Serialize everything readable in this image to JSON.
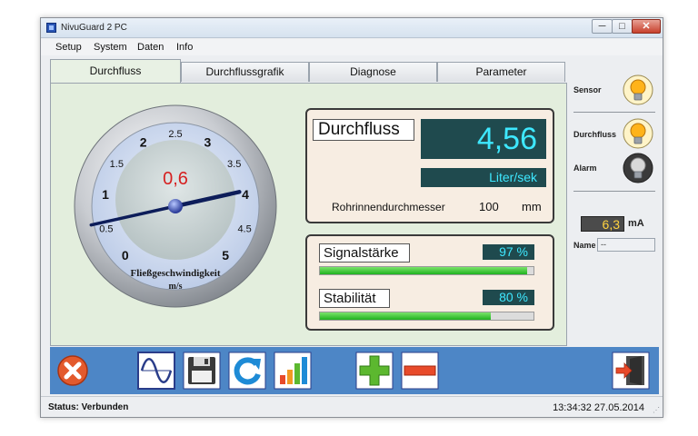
{
  "window": {
    "title": "NivuGuard 2  PC",
    "minimize": "─",
    "maximize": "□",
    "close": "✕"
  },
  "menu": [
    "Setup",
    "System",
    "Daten",
    "Info"
  ],
  "tabs": [
    {
      "label": "Durchfluss",
      "active": true
    },
    {
      "label": "Durchflussgrafik",
      "active": false
    },
    {
      "label": "Diagnose",
      "active": false
    },
    {
      "label": "Parameter",
      "active": false
    }
  ],
  "gauge": {
    "ticks": [
      "0",
      "0.5",
      "1",
      "1.5",
      "2",
      "2.5",
      "3",
      "3.5",
      "4",
      "4.5",
      "5"
    ],
    "value_display": "0,6",
    "needle_value": 0.6,
    "scale_min": 0,
    "scale_max": 5,
    "label": "Fließgeschwindigkeit",
    "unit": "m/s"
  },
  "flow": {
    "title": "Durchfluss",
    "value": "4,56",
    "unit": "Liter/sek",
    "diameter_label": "Rohrinnendurchmesser",
    "diameter_value": "100",
    "diameter_unit": "mm"
  },
  "signal": {
    "strength_label": "Signalstärke",
    "strength_value": "97 %",
    "strength_level": 97,
    "stability_label": "Stabilität",
    "stability_value": "80 %",
    "stability_level": 80
  },
  "side": {
    "sensor_label": "Sensor",
    "durchfluss_label": "Durchfluss",
    "alarm_label": "Alarm",
    "current_value": "6,3",
    "current_unit": "mA",
    "name_label": "Name",
    "name_value": "--"
  },
  "status": {
    "text": "Status: Verbunden",
    "time": "13:34:32 27.05.2014",
    "grip": "⋰"
  },
  "colors": {
    "toolbar": "#4d86c6",
    "display_bg": "#1f4a4e",
    "display_text": "#3ee8ff",
    "bar": "#1fb21f",
    "lamp_on": "#ffb31a",
    "lamp_off": "#d8d8d8"
  },
  "toolbar_icons": [
    "close-icon",
    "sine-wave-icon",
    "save-icon",
    "refresh-icon",
    "bar-chart-icon",
    "plus-icon",
    "minus-icon",
    "exit-icon"
  ]
}
